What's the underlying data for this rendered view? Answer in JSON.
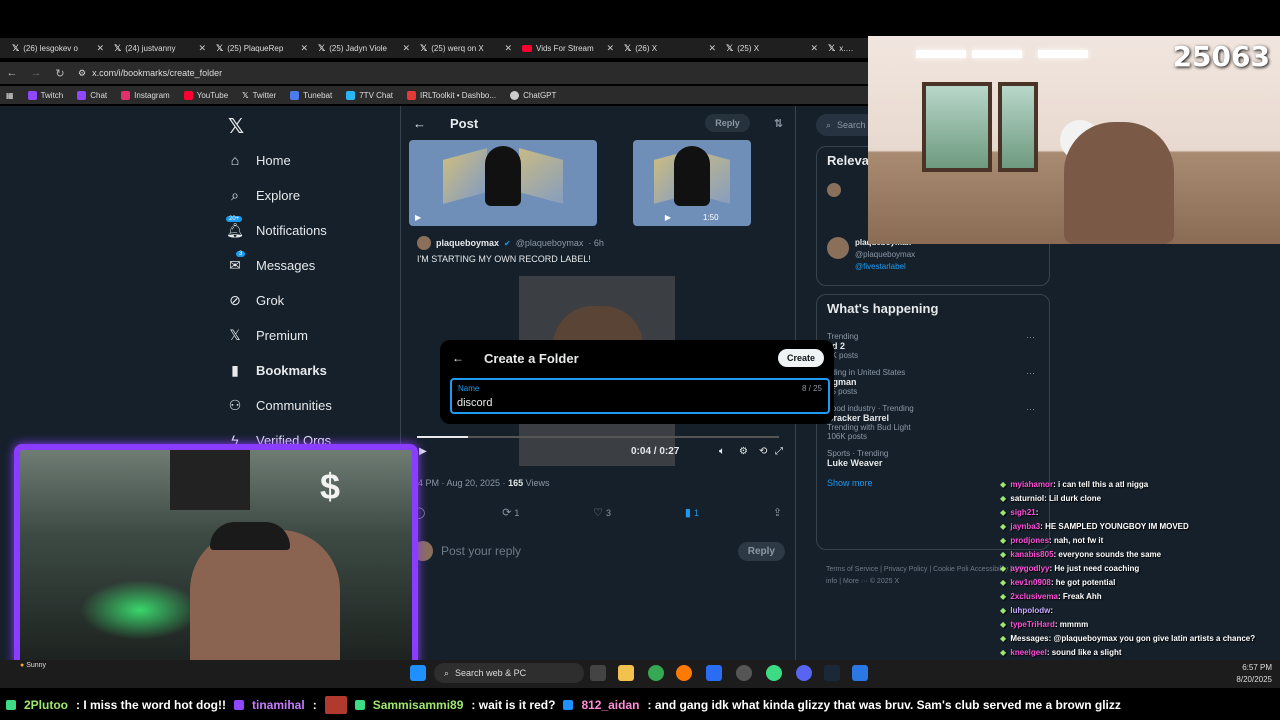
{
  "browser": {
    "tabs": [
      {
        "title": "(26) lesgokev o",
        "icon": "x-logo-icon"
      },
      {
        "title": "(24) justvanny",
        "icon": "x-logo-icon"
      },
      {
        "title": "(25) PlaqueRep",
        "icon": "x-logo-icon"
      },
      {
        "title": "(25) Jadyn Viole",
        "icon": "x-logo-icon"
      },
      {
        "title": "(25) werq on X",
        "icon": "x-logo-icon"
      },
      {
        "title": "Vids For Stream",
        "icon": "youtube-icon"
      },
      {
        "title": "(26) X",
        "icon": "x-logo-icon"
      },
      {
        "title": "(25) X",
        "icon": "x-logo-icon"
      },
      {
        "title": "x.com",
        "icon": "x-logo-icon"
      }
    ],
    "url": "x.com/i/bookmarks/create_folder",
    "bookmarks": [
      {
        "label": "Twitch",
        "color": "#9146ff"
      },
      {
        "label": "Chat",
        "color": "#9146ff"
      },
      {
        "label": "Instagram",
        "color": "#e1306c"
      },
      {
        "label": "YouTube",
        "color": "#ff0033"
      },
      {
        "label": "Twitter",
        "color": "#ffffff"
      },
      {
        "label": "Tunebat",
        "color": "#4b7bec"
      },
      {
        "label": "7TV Chat",
        "color": "#29b6f6"
      },
      {
        "label": "IRLToolkit • Dashbo...",
        "color": "#e53935"
      },
      {
        "label": "ChatGPT",
        "color": "#cccccc"
      }
    ]
  },
  "nav": {
    "items": [
      {
        "label": "Home",
        "icon": "home-icon"
      },
      {
        "label": "Explore",
        "icon": "search-icon"
      },
      {
        "label": "Notifications",
        "icon": "bell-icon",
        "badge": "20+"
      },
      {
        "label": "Messages",
        "icon": "mail-icon",
        "badge": "3"
      },
      {
        "label": "Grok",
        "icon": "grok-icon"
      },
      {
        "label": "Premium",
        "icon": "x-premium-icon"
      },
      {
        "label": "Bookmarks",
        "icon": "bookmark-icon",
        "active": true
      },
      {
        "label": "Communities",
        "icon": "people-icon"
      },
      {
        "label": "Verified Orgs",
        "icon": "lightning-icon"
      }
    ]
  },
  "post": {
    "header_title": "Post",
    "reply_label": "Reply",
    "media_duration": "1:50",
    "author_name": "plaqueboymax",
    "author_handle": "@plaqueboymax",
    "time": "· 6h",
    "text": "I'M STARTING MY OWN RECORD LABEL!",
    "video_time": "0:04 / 0:27",
    "posted_at": "44 PM · Aug 20, 2025 ·",
    "views_count": "165",
    "views_label": "Views",
    "replies": "1",
    "reposts": "1",
    "likes": "3",
    "bookmarks": "1",
    "reply_placeholder": "Post your reply",
    "reply_button": "Reply",
    "video_progress": 0.14
  },
  "modal": {
    "title": "Create a Folder",
    "create_label": "Create",
    "field_label": "Name",
    "field_count": "8 / 25",
    "field_value": "discord"
  },
  "right": {
    "search_placeholder": "Search",
    "relevant_title": "Releva",
    "relevant_user": {
      "name": "plaqueboymax",
      "handle": "@plaqueboymax",
      "link": "@fivestarlabel"
    },
    "happening_title": "What's happening",
    "trends": [
      {
        "cat": "Trending",
        "name": "ed 2",
        "count": "5K posts"
      },
      {
        "cat": "nding in United States",
        "name": "ngman",
        "count": "65 posts"
      },
      {
        "cat": "Food industry · Trending",
        "name": "Cracker Barrel",
        "count": "Trending with Bud Light",
        "count2": "106K posts"
      },
      {
        "cat": "Sports · Trending",
        "name": "Luke Weaver",
        "count": ""
      }
    ],
    "show_more": "Show more",
    "footer": "Terms of Service  |  Privacy Policy  |  Cookie Poli  Accessibility  |  Ads info  |  More ···  © 2025 X"
  },
  "stream": {
    "viewer_count": "25063",
    "chat": [
      {
        "user": "myiahamor",
        "text": "i can tell this a atl nigga",
        "color": "#ff4fd8"
      },
      {
        "user": "saturniol",
        "text": "Lil durk clone",
        "color": "#ffffff"
      },
      {
        "user": "sigh21",
        "text": "",
        "color": "#ff4fd8"
      },
      {
        "user": "jaynba3",
        "text": "HE SAMPLED YOUNGBOY IM MOVED",
        "color": "#ff4fd8"
      },
      {
        "user": "prodjones",
        "text": "nah, not fw it",
        "color": "#ff4fd8"
      },
      {
        "user": "kanabis805",
        "text": "everyone sounds the same",
        "color": "#ff4fd8"
      },
      {
        "user": "ayygodlyy",
        "text": "He just need coaching",
        "color": "#ff4fd8"
      },
      {
        "user": "kev1n0908",
        "text": "he got potential",
        "color": "#ff4fd8"
      },
      {
        "user": "2xclusivema",
        "text": "Freak Ahh",
        "color": "#ff4fd8"
      },
      {
        "user": "luhpolodw",
        "text": "",
        "color": "#c8a8ff"
      },
      {
        "user": "typeTriHard",
        "text": "mmmm",
        "color": "#ff4fd8"
      },
      {
        "user": "Messages",
        "text": "@plaqueboymax you gon give latin artists a chance?",
        "color": "#ffffff"
      },
      {
        "user": "kneelgeel",
        "text": "sound like a slight",
        "color": "#ff4fd8"
      }
    ]
  },
  "taskbar": {
    "weather": "Sunny",
    "search_placeholder": "Search web & PC",
    "time": "6:57 PM",
    "date": "8/20/2025"
  },
  "ticker": [
    {
      "user": "2Plutoo",
      "text": ": I miss the word hot dog!!"
    },
    {
      "user": "tinamihal",
      "text": ":"
    },
    {
      "user": "Sammisammi89",
      "text": ": wait is it red?"
    },
    {
      "user": "812_aidan",
      "text": ": and gang idk what kinda glizzy that was bruv. Sam's club served me a brown glizz"
    }
  ]
}
